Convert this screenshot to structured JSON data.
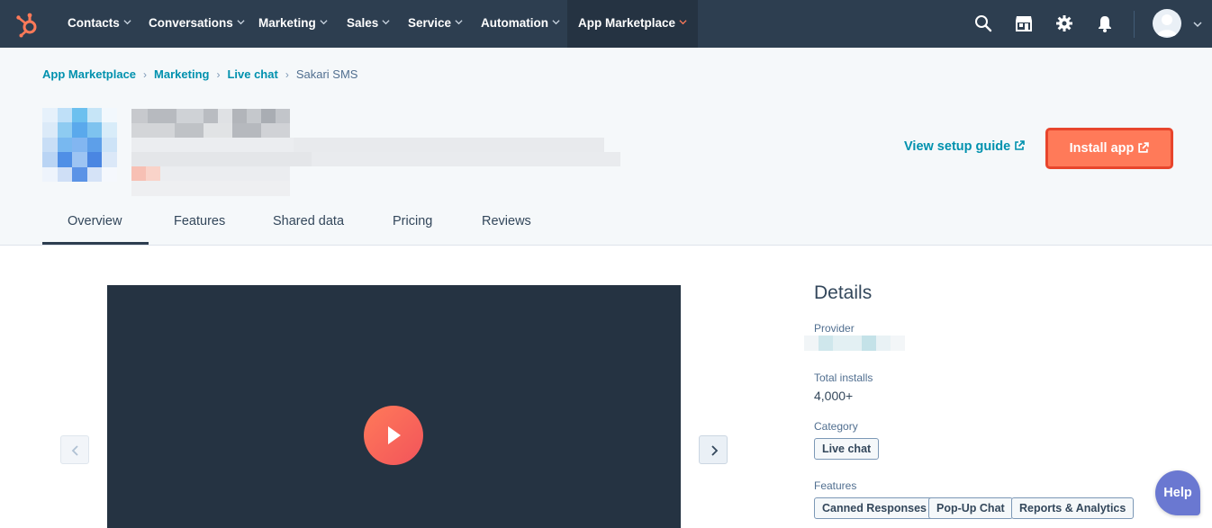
{
  "nav": {
    "items": [
      {
        "label": "Contacts"
      },
      {
        "label": "Conversations"
      },
      {
        "label": "Marketing"
      },
      {
        "label": "Sales"
      },
      {
        "label": "Service"
      },
      {
        "label": "Automation"
      },
      {
        "label": "App Marketplace"
      }
    ],
    "icons": [
      "search-icon",
      "marketplace-icon",
      "settings-icon",
      "notifications-icon"
    ],
    "colors": {
      "bar": "#2d3e50",
      "active": "#253342",
      "accent": "#ff7a59"
    }
  },
  "breadcrumb": {
    "items": [
      "App Marketplace",
      "Marketing",
      "Live chat"
    ],
    "current": "Sakari SMS"
  },
  "header": {
    "setup_guide_label": "View setup guide",
    "install_label": "Install app"
  },
  "tabs": [
    {
      "label": "Overview"
    },
    {
      "label": "Features"
    },
    {
      "label": "Shared data"
    },
    {
      "label": "Pricing"
    },
    {
      "label": "Reviews"
    }
  ],
  "details": {
    "title": "Details",
    "provider_label": "Provider",
    "installs_label": "Total installs",
    "installs_value": "4,000+",
    "category_label": "Category",
    "category_tag": "Live chat",
    "features_label": "Features",
    "feature_tags": [
      "Canned Responses",
      "Pop-Up Chat",
      "Reports & Analytics"
    ]
  },
  "help_label": "Help"
}
